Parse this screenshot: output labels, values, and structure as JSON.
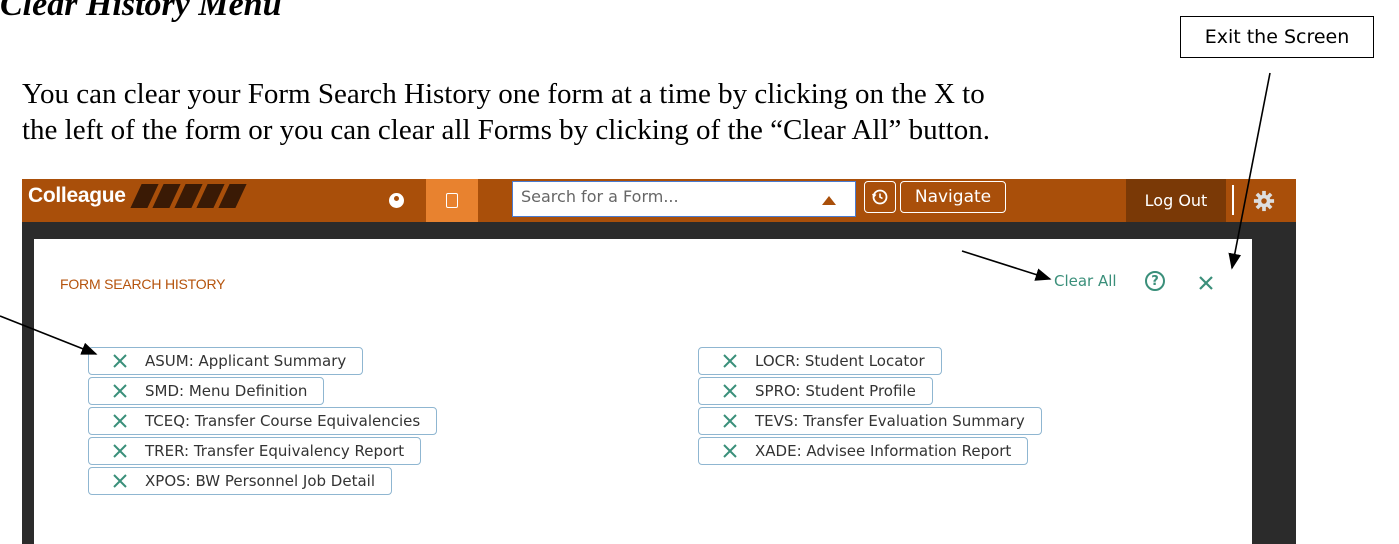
{
  "doc": {
    "heading": "Clear History Menu",
    "callout": "Exit the Screen",
    "paragraph_line1": "You can clear your Form Search History one form at a time by clicking on the X to",
    "paragraph_line2": "the left of the form or you can clear all Forms by clicking of the “Clear All” button."
  },
  "topbar": {
    "logo": "Colleague",
    "search_placeholder": "Search for a Form...",
    "navigate_label": "Navigate",
    "logout_label": "Log Out"
  },
  "panel": {
    "title": "FORM SEARCH HISTORY",
    "clear_all": "Clear All",
    "help": "?"
  },
  "history": {
    "left": [
      "ASUM: Applicant Summary",
      "SMD: Menu Definition",
      "TCEQ: Transfer Course Equivalencies",
      "TRER: Transfer Equivalency Report",
      "XPOS: BW Personnel Job Detail"
    ],
    "right": [
      "LOCR: Student Locator",
      "SPRO: Student Profile",
      "TEVS: Transfer Evaluation Summary",
      "XADE: Advisee Information Report"
    ]
  },
  "colors": {
    "brand": "#a94f0a",
    "accent": "#e8822f",
    "teal": "#3a8f7a",
    "title": "#b5530c"
  }
}
